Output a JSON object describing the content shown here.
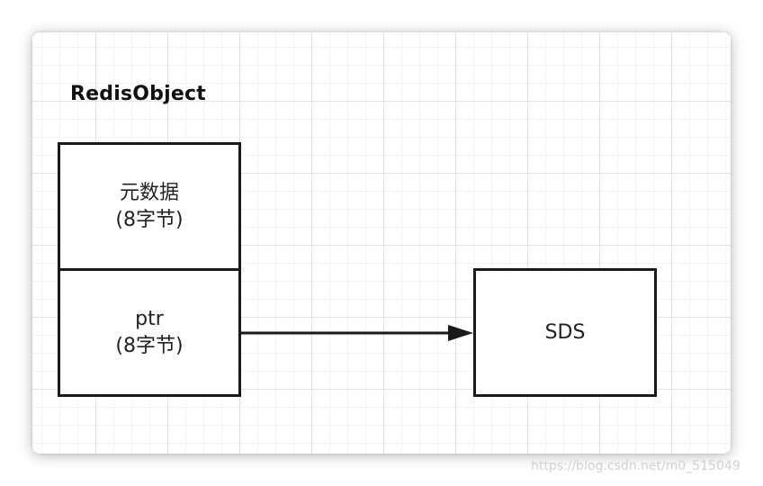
{
  "diagram": {
    "title": "RedisObject",
    "metadata_box": {
      "line1": "元数据",
      "line2": "(8字节)"
    },
    "ptr_box": {
      "line1": "ptr",
      "line2": "(8字节)"
    },
    "sds_box": {
      "label": "SDS"
    },
    "arrow": {
      "from": "ptr",
      "to": "SDS"
    }
  },
  "watermark": {
    "text": "https://blog.csdn.net/m0_515049"
  },
  "colors": {
    "border": "#1a1a1a",
    "grid": "#e4e4e4",
    "background": "#ffffff"
  }
}
